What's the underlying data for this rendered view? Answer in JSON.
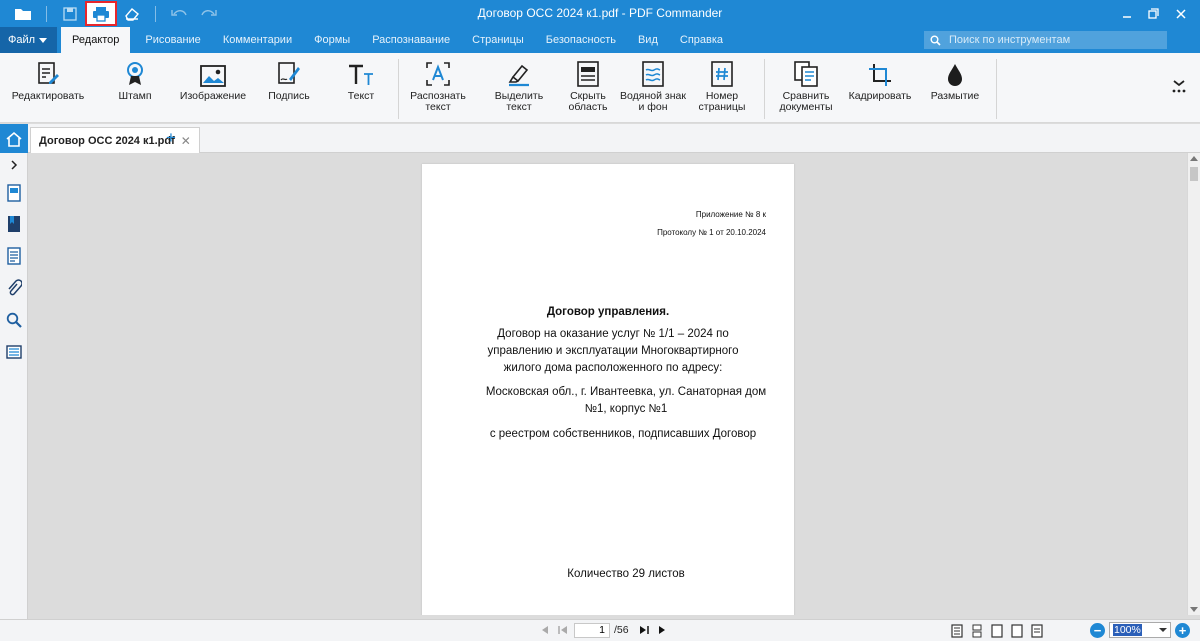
{
  "window": {
    "title": "Договор ОСС 2024 к1.pdf - PDF Commander"
  },
  "menu": {
    "file_label": "Файл",
    "tabs": [
      {
        "label": "Редактор",
        "active": true
      },
      {
        "label": "Рисование"
      },
      {
        "label": "Комментарии"
      },
      {
        "label": "Формы"
      },
      {
        "label": "Распознавание"
      },
      {
        "label": "Страницы"
      },
      {
        "label": "Безопасность"
      },
      {
        "label": "Вид"
      },
      {
        "label": "Справка"
      }
    ],
    "search_placeholder": "Поиск по инструментам"
  },
  "ribbon": {
    "items": [
      {
        "label": "Редактировать",
        "icon": "edit-document-icon"
      },
      {
        "label": "Штамп",
        "icon": "stamp-icon"
      },
      {
        "label": "Изображение",
        "icon": "image-icon"
      },
      {
        "label": "Подпись",
        "icon": "signature-icon"
      },
      {
        "label": "Текст",
        "icon": "text-icon"
      },
      {
        "label": "Распознать\nтекст",
        "icon": "ocr-icon"
      },
      {
        "label": "Выделить\nтекст",
        "icon": "highlighter-icon"
      },
      {
        "label": "Скрыть\nобласть",
        "icon": "redact-icon"
      },
      {
        "label": "Водяной знак\nи фон",
        "icon": "watermark-icon"
      },
      {
        "label": "Номер\nстраницы",
        "icon": "page-number-icon"
      },
      {
        "label": "Сравнить\nдокументы",
        "icon": "compare-icon"
      },
      {
        "label": "Кадрировать",
        "icon": "crop-icon"
      },
      {
        "label": "Размытие",
        "icon": "blur-icon"
      }
    ]
  },
  "tabs": {
    "document_tab": "Договор ОСС 2024 к1.pdf"
  },
  "document": {
    "line1": "Приложение № 8 к",
    "line2": "Протоколу № 1 от 20.10.2024",
    "title": "Договор управления.",
    "para1": "Договор на оказание услуг № 1/1 – 2024 по управлению и эксплуатации Многоквартирного жилого дома расположенного  по адресу:",
    "para2": "Московская обл., г. Ивантеевка, ул. Санаторная дом №1, корпус №1",
    "para3": "с реестром собственников, подписавших Договор",
    "count": "Количество 29 листов"
  },
  "status": {
    "current_page": "1",
    "total_pages": "/56",
    "zoom": "100%"
  },
  "colors": {
    "accent": "#1f88d4",
    "highlight_box": "#e8262b"
  }
}
